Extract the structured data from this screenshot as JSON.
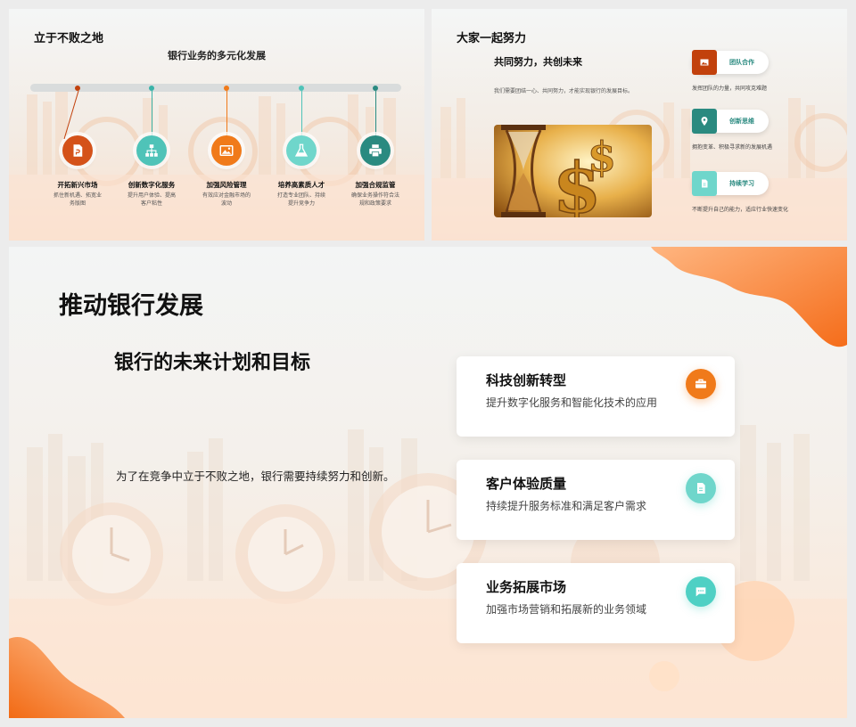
{
  "slide1": {
    "title": "立于不败之地",
    "subtitle": "银行业务的多元化发展",
    "steps": [
      {
        "title": "开拓新兴市场",
        "desc": "抓住新机遇、拓宽业务版图",
        "color": "#d4521a",
        "icon": "document-icon"
      },
      {
        "title": "创新数字化服务",
        "desc": "提升用户体验、提高客户粘性",
        "color": "#4fc3b8",
        "icon": "sitemap-icon"
      },
      {
        "title": "加强风险管理",
        "desc": "有效应对金融市场的波动",
        "color": "#f07a1a",
        "icon": "image-icon"
      },
      {
        "title": "培养高素质人才",
        "desc": "打造专业团队、持续提升竞争力",
        "color": "#6fd6cb",
        "icon": "flask-icon"
      },
      {
        "title": "加强合规监管",
        "desc": "确保业务操作符合法规和政策要求",
        "color": "#2a8a80",
        "icon": "printer-icon"
      }
    ]
  },
  "slide2": {
    "title": "大家一起努力",
    "subtitle": "共同努力，共创未来",
    "desc": "我们需要团结一心、共同努力，才能实现银行的发展目标。",
    "items": [
      {
        "label": "团队合作",
        "desc": "发挥团队的力量，共同攻克难题",
        "color": "#c2410c",
        "icon": "image-icon"
      },
      {
        "label": "创新思维",
        "desc": "拥抱变革、积极寻求新的发展机遇",
        "color": "#2a8a80",
        "icon": "location-icon"
      },
      {
        "label": "持续学习",
        "desc": "不断提升自己的能力，适应行业快速变化",
        "color": "#6fd6cb",
        "icon": "document-icon"
      }
    ]
  },
  "slide3": {
    "title": "推动银行发展",
    "subtitle": "银行的未来计划和目标",
    "desc": "为了在竞争中立于不败之地，银行需要持续努力和创新。",
    "cards": [
      {
        "title": "科技创新转型",
        "desc": "提升数字化服务和智能化技术的应用",
        "color": "#f07a1a",
        "icon": "briefcase-icon"
      },
      {
        "title": "客户体验质量",
        "desc": "持续提升服务标准和满足客户需求",
        "color": "#6fd6cb",
        "icon": "document-icon"
      },
      {
        "title": "业务拓展市场",
        "desc": "加强市场营销和拓展新的业务领域",
        "color": "#4fd0c4",
        "icon": "chat-icon"
      }
    ]
  }
}
